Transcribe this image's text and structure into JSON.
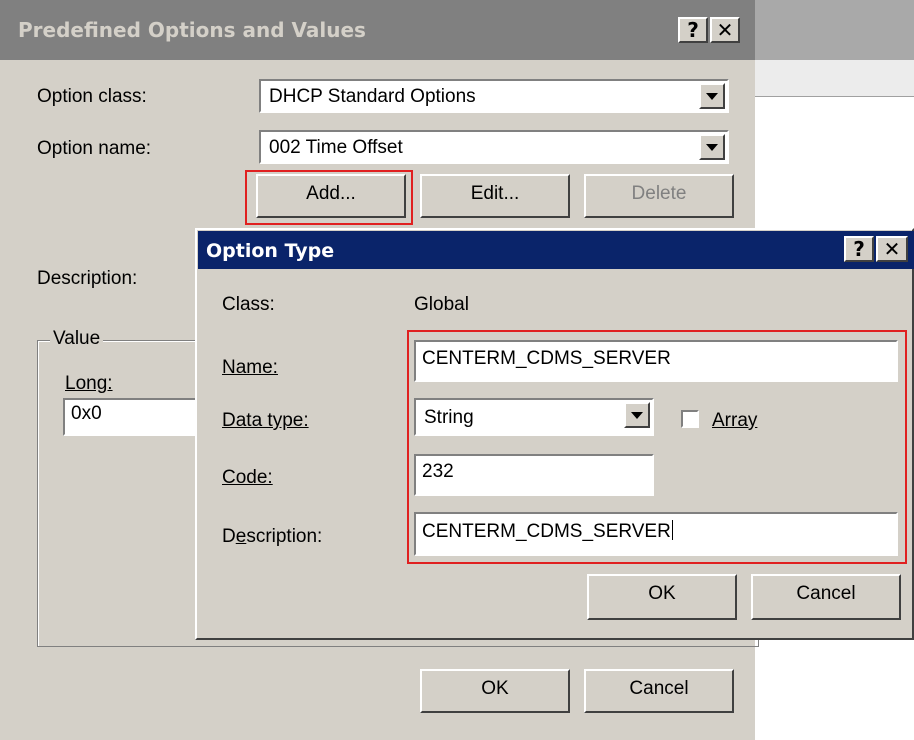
{
  "main_dialog": {
    "title": "Predefined Options and Values",
    "help_glyph": "?",
    "close_glyph": "✕",
    "option_class_label": "Option class:",
    "option_class_value": "DHCP Standard Options",
    "option_name_label": "Option name:",
    "option_name_value": "002 Time Offset",
    "add_button": "Add...",
    "edit_button": "Edit...",
    "delete_button": "Delete",
    "description_label": "Description:",
    "value_group_label": "Value",
    "long_label": "Long:",
    "long_value": "0x0",
    "ok_button": "OK",
    "cancel_button": "Cancel"
  },
  "option_type_dialog": {
    "title": "Option Type",
    "help_glyph": "?",
    "close_glyph": "✕",
    "class_label": "Class:",
    "class_value": "Global",
    "name_label": "Name:",
    "name_value": "CENTERM_CDMS_SERVER",
    "data_type_label": "Data type:",
    "data_type_value": "String",
    "array_label": "Array",
    "array_checked": false,
    "code_label": "Code:",
    "code_value": "232",
    "description_label": "Description:",
    "description_value": "CENTERM_CDMS_SERVER",
    "ok_button": "OK",
    "cancel_button": "Cancel"
  },
  "colors": {
    "highlight_box": "#e02020",
    "active_title": "#0a246a",
    "inactive_title": "#808080",
    "dialog_face": "#d4d0c8"
  }
}
